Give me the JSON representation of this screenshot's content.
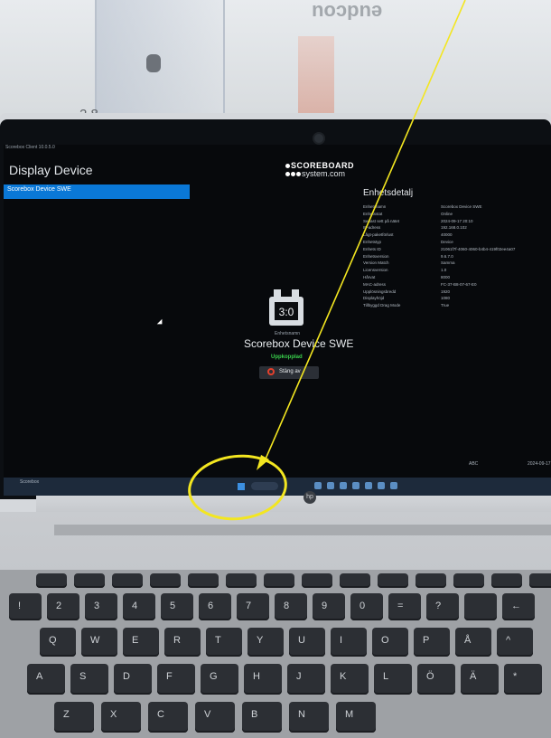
{
  "background": {
    "rink_text": "eudcou",
    "side_number": "2 8"
  },
  "app": {
    "titlebar": "Scorebox Client 10.0.5.0",
    "window_title": "Display Device",
    "sidebar_selected": "Scorebox Device SWE"
  },
  "brand": {
    "line1": "SCOREBOARD",
    "line2": "system.com"
  },
  "device": {
    "subtitle": "Enhetsnamn",
    "name": "Scorebox Device SWE",
    "status": "Uppkopplad",
    "close_label": "Stäng av"
  },
  "details": {
    "heading": "Enhetsdetalj",
    "rows": [
      {
        "k": "Enhetsnamn",
        "v": "Scorebox Device SWE"
      },
      {
        "k": "Enhetsstat",
        "v": "Online"
      },
      {
        "k": "Senast sett på nätet",
        "v": "2024-09-17 20:10"
      },
      {
        "k": "IP-adress",
        "v": "192.168.0.102"
      },
      {
        "k": "Lågt-paketförlust",
        "v": "40000"
      },
      {
        "k": "Enhetstyp",
        "v": "Device"
      },
      {
        "k": "Enhets ID",
        "v": "21061f7f-4060-4060-b4b4-419f02ee4a07"
      },
      {
        "k": "Enhetsversion",
        "v": "9.6.7.0"
      },
      {
        "k": "Version Match",
        "v": "Samma"
      },
      {
        "k": "Licensversion",
        "v": "1.0"
      },
      {
        "k": "Hårvat",
        "v": "8000"
      },
      {
        "k": "MAC-adress",
        "v": "FC-37-B8-07-67-E0"
      },
      {
        "k": "Upplösningsbredd",
        "v": "1920"
      },
      {
        "k": "Displayhöjd",
        "v": "1080"
      },
      {
        "k": "Tillbyggd Drag Mode",
        "v": "True"
      }
    ]
  },
  "taskbar": {
    "left_text": "Scorebox",
    "right_a": "ABC",
    "right_b": "2024-09-17"
  },
  "keyboard": {
    "row_top": [
      "",
      "",
      "",
      "",
      "",
      "",
      "",
      "",
      "",
      "",
      "",
      "",
      "",
      ""
    ],
    "row_num": [
      "!",
      "2",
      "3",
      "4",
      "5",
      "6",
      "7",
      "8",
      "9",
      "0",
      "=",
      "?",
      "",
      "←"
    ],
    "row_q": [
      "Q",
      "W",
      "E",
      "R",
      "T",
      "Y",
      "U",
      "I",
      "O",
      "P",
      "Å",
      "^"
    ],
    "row_a": [
      "A",
      "S",
      "D",
      "F",
      "G",
      "H",
      "J",
      "K",
      "L",
      "Ö",
      "Ä",
      "*"
    ],
    "row_z": [
      "Z",
      "X",
      "C",
      "V",
      "B",
      "N",
      "M"
    ]
  },
  "annotation_color": "#f3e620"
}
